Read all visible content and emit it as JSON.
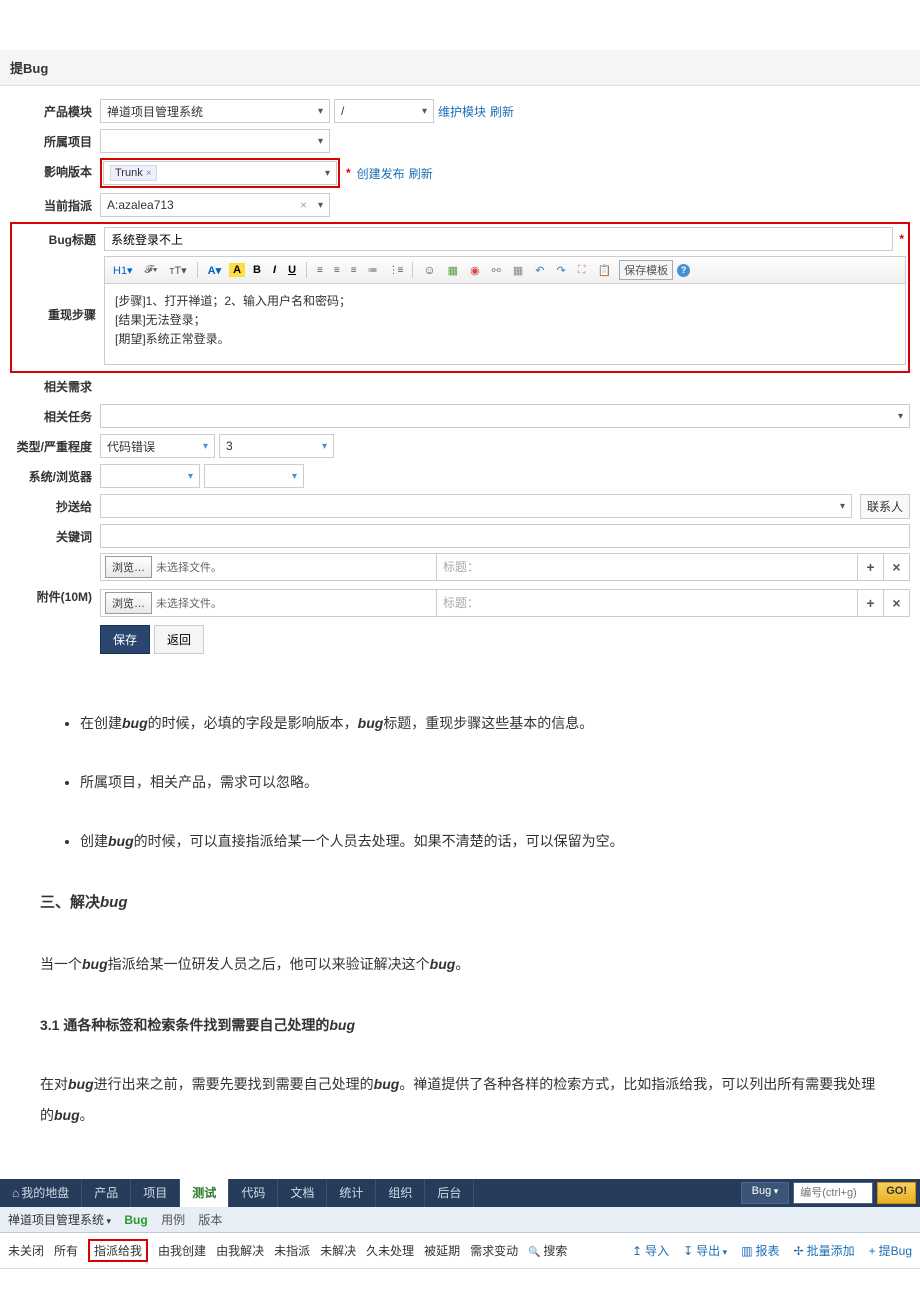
{
  "title": "提Bug",
  "labels": {
    "product_module": "产品模块",
    "project": "所属项目",
    "version": "影响版本",
    "assign": "当前指派",
    "bug_title": "Bug标题",
    "steps": "重现步骤",
    "related_req": "相关需求",
    "related_task": "相关任务",
    "type_severity": "类型/严重程度",
    "os_browser": "系统/浏览器",
    "cc": "抄送给",
    "keywords": "关键词",
    "attachment": "附件(10M)"
  },
  "values": {
    "product": "禅道项目管理系统",
    "module_path": "/",
    "maintain_module": "维护模块",
    "refresh": "刷新",
    "version_tag": "Trunk",
    "create_release": "创建发布",
    "assign_to": "A:azalea713",
    "bug_title_text": "系统登录不上",
    "steps_line1": "[步骤]1、打开禅道；2、输入用户名和密码；",
    "steps_line2": "[结果]无法登录；",
    "steps_line3": "[期望]系统正常登录。",
    "type": "代码错误",
    "severity": "3",
    "browse": "浏览…",
    "no_file": "未选择文件。",
    "file_title_ph": "标题：",
    "save": "保存",
    "back": "返回",
    "save_template": "保存模板",
    "contacts": "联系人"
  },
  "toolbar": {
    "h1": "H1▾",
    "font": "𝓕▾",
    "size": "тT▾",
    "color": "A▾",
    "highlight": "A",
    "bold": "B",
    "italic": "I",
    "underline": "U"
  },
  "article": {
    "bullet1a": "在创建",
    "bullet1b": "bug",
    "bullet1c": "的时候，必填的字段是影响版本，",
    "bullet1d": "bug",
    "bullet1e": "标题，重现步骤这些基本的信息。",
    "bullet2": "所属项目，相关产品，需求可以忽略。",
    "bullet3a": "创建",
    "bullet3b": "bug",
    "bullet3c": "的时候，可以直接指派给某一个人员去处理。如果不清楚的话，可以保留为空。",
    "h2a": "三、解决",
    "h2b": "bug",
    "p1a": "当一个",
    "p1b": "bug",
    "p1c": "指派给某一位研发人员之后，他可以来验证解决这个",
    "p1d": "bug",
    "p1e": "。",
    "h3a": "3.1",
    "h3b": " 通各种标签和检索条件找到需要自己处理的",
    "h3c": "bug",
    "p2a": "在对",
    "p2b": "bug",
    "p2c": "进行出来之前，需要先要找到需要自己处理的",
    "p2d": "bug",
    "p2e": "。禅道提供了各种各样的检索方式，比如指派给我，可以列出所有需要我处理的",
    "p2f": "bug",
    "p2g": "。"
  },
  "nav": {
    "items": [
      "我的地盘",
      "产品",
      "项目",
      "测试",
      "代码",
      "文档",
      "统计",
      "组织",
      "后台"
    ],
    "active_index": 3,
    "search_type": "Bug",
    "search_ph": "编号(ctrl+g)",
    "go": "GO!"
  },
  "subnav": {
    "product": "禅道项目管理系统",
    "tabs": [
      "Bug",
      "用例",
      "版本"
    ],
    "active_index": 0
  },
  "filters": {
    "items": [
      "未关闭",
      "所有",
      "指派给我",
      "由我创建",
      "由我解决",
      "未指派",
      "未解决",
      "久未处理",
      "被延期",
      "需求变动"
    ],
    "boxed_index": 2,
    "search": "搜索",
    "actions": {
      "import": "导入",
      "export": "导出",
      "report": "报表",
      "batch_add": "批量添加",
      "add_bug": "提Bug"
    }
  }
}
